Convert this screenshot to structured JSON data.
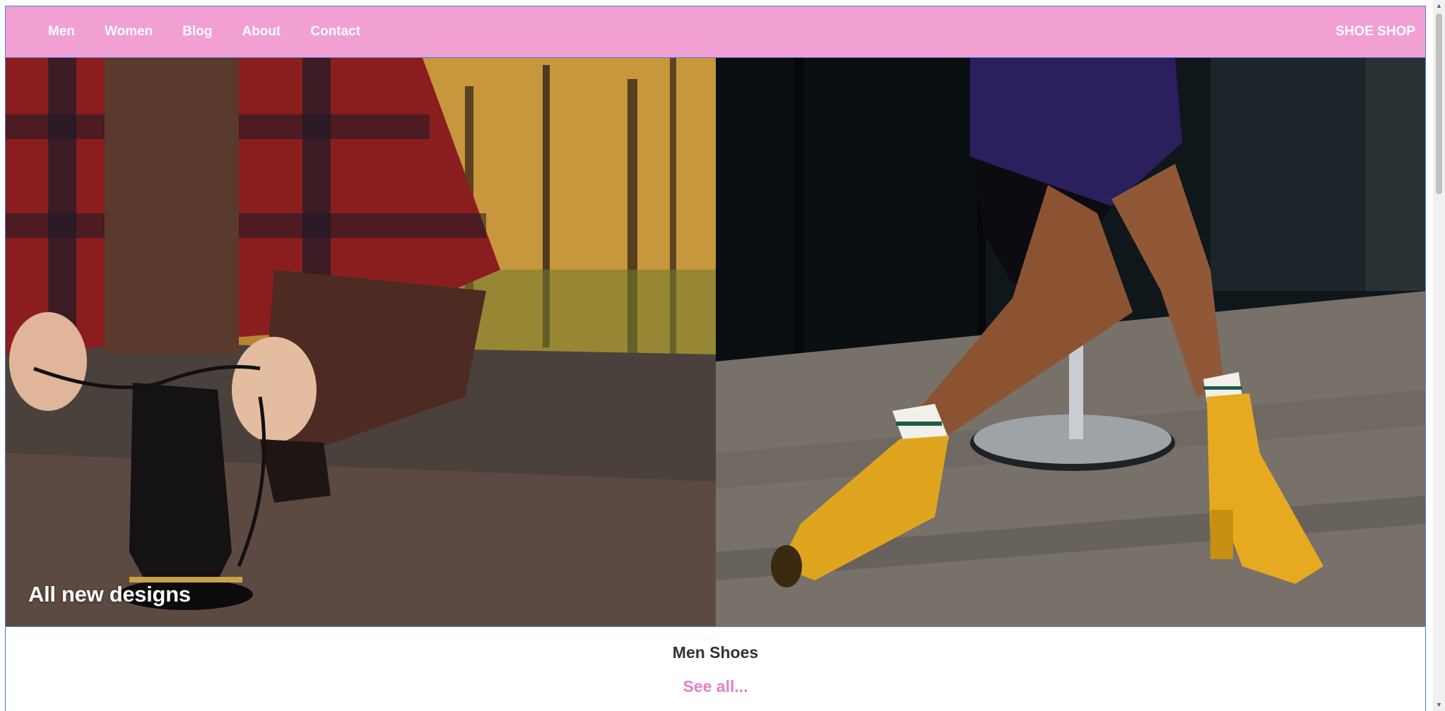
{
  "nav": {
    "links": [
      "Men",
      "Women",
      "Blog",
      "About",
      "Contact"
    ],
    "brand": "SHOE SHOP"
  },
  "hero": {
    "caption": "All new designs",
    "left_image": "man-tying-boot-laces-photo",
    "right_image": "woman-yellow-ankle-boots-photo"
  },
  "section": {
    "title": "Men Shoes",
    "see_all": "See all..."
  },
  "colors": {
    "nav_bg": "#f29fd4",
    "accent_pink": "#e67fc8",
    "border_blue": "#4a7fe6"
  },
  "icons": {
    "scroll_up": "chevron-up-icon",
    "scroll_down": "chevron-down-icon"
  }
}
